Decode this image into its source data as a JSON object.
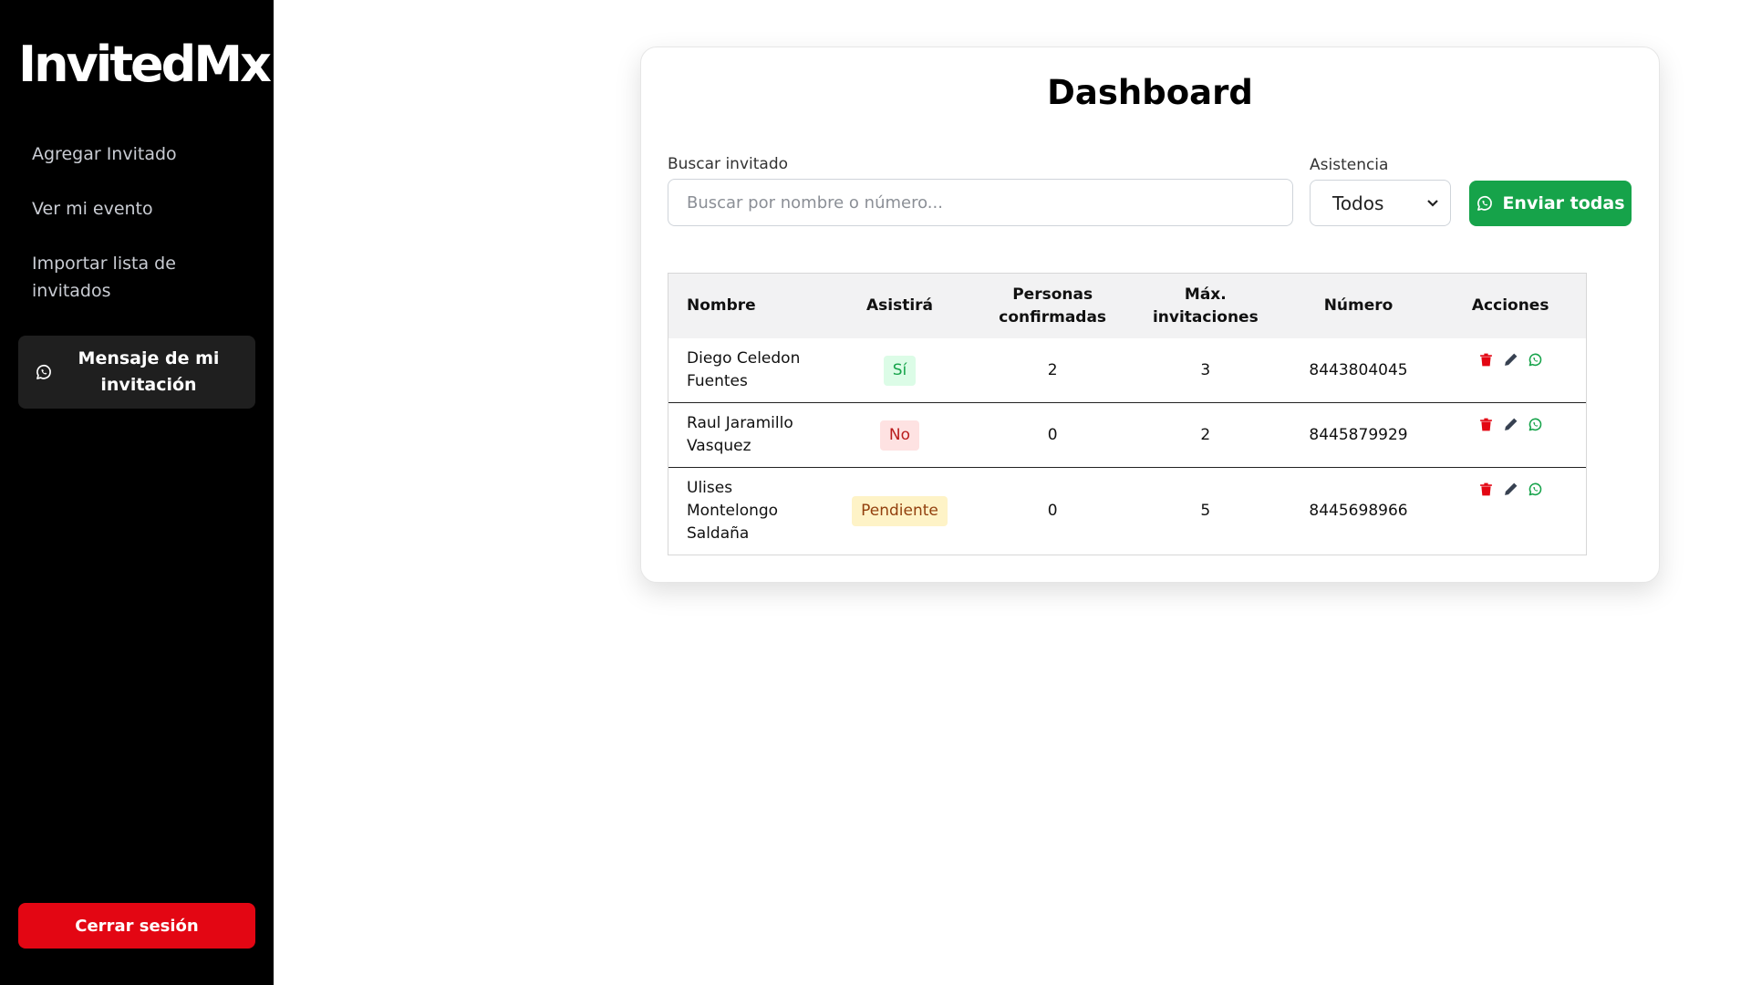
{
  "sidebar": {
    "logo": "InvitedMx",
    "items": [
      {
        "label": "Agregar Invitado"
      },
      {
        "label": "Ver mi evento"
      },
      {
        "label": "Importar lista de invitados"
      }
    ],
    "message_button": "Mensaje de mi invitación",
    "logout": "Cerrar sesión"
  },
  "dashboard": {
    "title": "Dashboard",
    "search_label": "Buscar invitado",
    "search_placeholder": "Buscar por nombre o número...",
    "attendance_label": "Asistencia",
    "attendance_selected": "Todos",
    "send_all": "Enviar todas"
  },
  "table": {
    "headers": [
      "Nombre",
      "Asistirá",
      "Personas confirmadas",
      "Máx. invitaciones",
      "Número",
      "Acciones"
    ],
    "rows": [
      {
        "name": "Diego Celedon Fuentes",
        "status": "Sí",
        "confirmed": "2",
        "max": "3",
        "phone": "8443804045"
      },
      {
        "name": "Raul Jaramillo Vasquez",
        "status": "No",
        "confirmed": "0",
        "max": "2",
        "phone": "8445879929"
      },
      {
        "name": "Ulises Montelongo Saldaña",
        "status": "Pendiente",
        "confirmed": "0",
        "max": "5",
        "phone": "8445698966"
      }
    ]
  },
  "icons": {
    "delete": "trash-icon",
    "edit": "pencil-icon",
    "whatsapp": "whatsapp-icon"
  },
  "colors": {
    "accent_green": "#16a34a",
    "danger_red": "#e30613",
    "sidebar_bg": "#000000"
  }
}
